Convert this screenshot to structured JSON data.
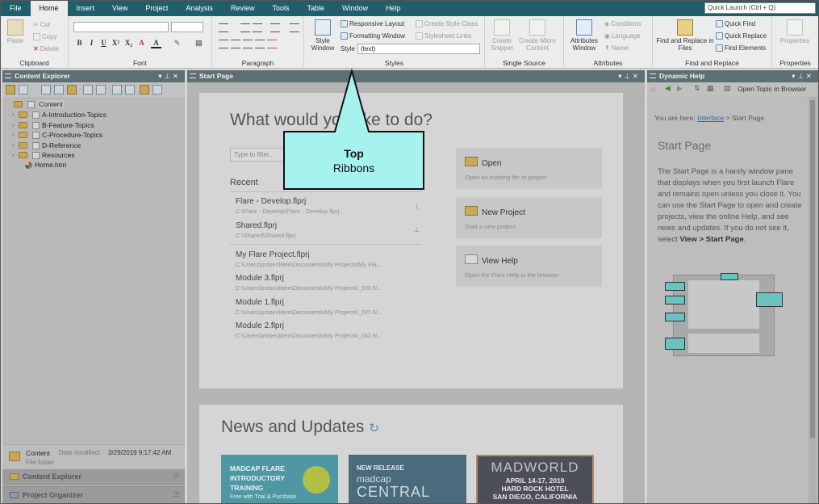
{
  "menu": {
    "items": [
      "File",
      "Home",
      "Insert",
      "View",
      "Project",
      "Analysis",
      "Review",
      "Tools",
      "Table",
      "Window",
      "Help"
    ],
    "active_index": 1,
    "quick_launch_placeholder": "Quick Launch (Ctrl + Q)"
  },
  "ribbon": {
    "clipboard": {
      "label": "Clipboard",
      "paste": "Paste",
      "cut": "Cut",
      "copy": "Copy",
      "delete": "Delete"
    },
    "font": {
      "label": "Font"
    },
    "paragraph": {
      "label": "Paragraph"
    },
    "styles": {
      "label": "Styles",
      "style_window": "Style Window",
      "responsive_layout": "Responsive Layout",
      "formatting_window": "Formatting Window",
      "create_style_class": "Create Style Class",
      "stylesheet_links": "Stylesheet Links",
      "style_label": "Style",
      "style_value": "(text)"
    },
    "single_source": {
      "label": "Single Source",
      "create_snippet": "Create Snippet",
      "create_micro_content": "Create Micro Content"
    },
    "attributes": {
      "label": "Attributes",
      "attributes_window": "Attributes Window",
      "conditions": "Conditions",
      "language": "Language",
      "name": "Name"
    },
    "find_replace": {
      "label": "Find and Replace",
      "find_replace_files": "Find and Replace in Files",
      "quick_find": "Quick Find",
      "quick_replace": "Quick Replace",
      "find_elements": "Find Elements"
    },
    "properties": {
      "label": "Properties",
      "properties_btn": "Properties"
    }
  },
  "content_explorer": {
    "title": "Content Explorer",
    "tree": [
      {
        "label": "Content",
        "type": "folder",
        "expandable": false
      },
      {
        "label": "A-Introduction-Topics",
        "type": "folder",
        "expandable": true
      },
      {
        "label": "B-Feature-Topics",
        "type": "folder",
        "expandable": true
      },
      {
        "label": "C-Procedure-Topics",
        "type": "folder",
        "expandable": true
      },
      {
        "label": "D-Reference",
        "type": "folder",
        "expandable": true
      },
      {
        "label": "Resources",
        "type": "folder",
        "expandable": true
      },
      {
        "label": "Home.htm",
        "type": "file",
        "expandable": false
      }
    ],
    "status": {
      "name": "Content",
      "date_label": "Date modified:",
      "date": "3/29/2019 9:17:42 AM",
      "kind": "File folder"
    },
    "bottom_tabs": [
      "Content Explorer",
      "Project Organizer"
    ]
  },
  "start_page": {
    "tab_title": "Start Page",
    "heading": "What would you like to do?",
    "filter_placeholder": "Type to filter...",
    "recent_label": "Recent",
    "recent": [
      {
        "name": "Flare - Develop.flprj",
        "path": "C:\\Flare - Develop\\Flare - Develop.flprj"
      },
      {
        "name": "Shared.flprj",
        "path": "C:\\Shared\\Shared.flprj"
      },
      {
        "name": "My Flare Project.flprj",
        "path": "C:\\Users\\pstoecklein\\Documents\\My Projects\\My Fla..."
      },
      {
        "name": "Module 3.flprj",
        "path": "C:\\Users\\pstoecklein\\Documents\\My Projects\\_DO N..."
      },
      {
        "name": "Module 1.flprj",
        "path": "C:\\Users\\pstoecklein\\Documents\\My Projects\\_DO N..."
      },
      {
        "name": "Module 2.flprj",
        "path": "C:\\Users\\pstoecklein\\Documents\\My Projects\\_DO N..."
      }
    ],
    "actions": [
      {
        "title": "Open",
        "subtitle": "Open an existing file or project"
      },
      {
        "title": "New Project",
        "subtitle": "Start a new project"
      },
      {
        "title": "View Help",
        "subtitle": "Open the Flare Help in the browser"
      }
    ],
    "news_heading": "News and Updates",
    "tiles": [
      {
        "line1": "MADCAP FLARE",
        "line2": "INTRODUCTORY",
        "line3": "TRAINING",
        "line4": "Free with Trial & Purchase",
        "color": "#4f97a2"
      },
      {
        "line1": "NEW RELEASE",
        "line2": "madcap",
        "line3": "CENTRAL",
        "color": "#4a6b7c"
      },
      {
        "line1": "MADWORLD",
        "line2": "APRIL 14-17, 2019",
        "line3": "HARD ROCK HOTEL",
        "line4": "SAN DIEGO, CALIFORNIA",
        "color": "#4c4f5a"
      }
    ]
  },
  "dynamic_help": {
    "title": "Dynamic Help",
    "open_topic": "Open Topic in Browser",
    "breadcrumb_prefix": "You are here:",
    "breadcrumb_link": "Interface",
    "breadcrumb_suffix": "> Start Page",
    "heading": "Start Page",
    "body": "The Start Page is a handy window pane that displays when you first launch Flare and remains open unless you close it. You can use the Start Page to open and create projects, view the online Help, and see news and updates. If you do not see it, select",
    "body_bold": "View > Start Page",
    "body_end": "."
  },
  "callout": {
    "title": "Top",
    "subtitle": "Ribbons",
    "fill": "#a6f2ee"
  }
}
